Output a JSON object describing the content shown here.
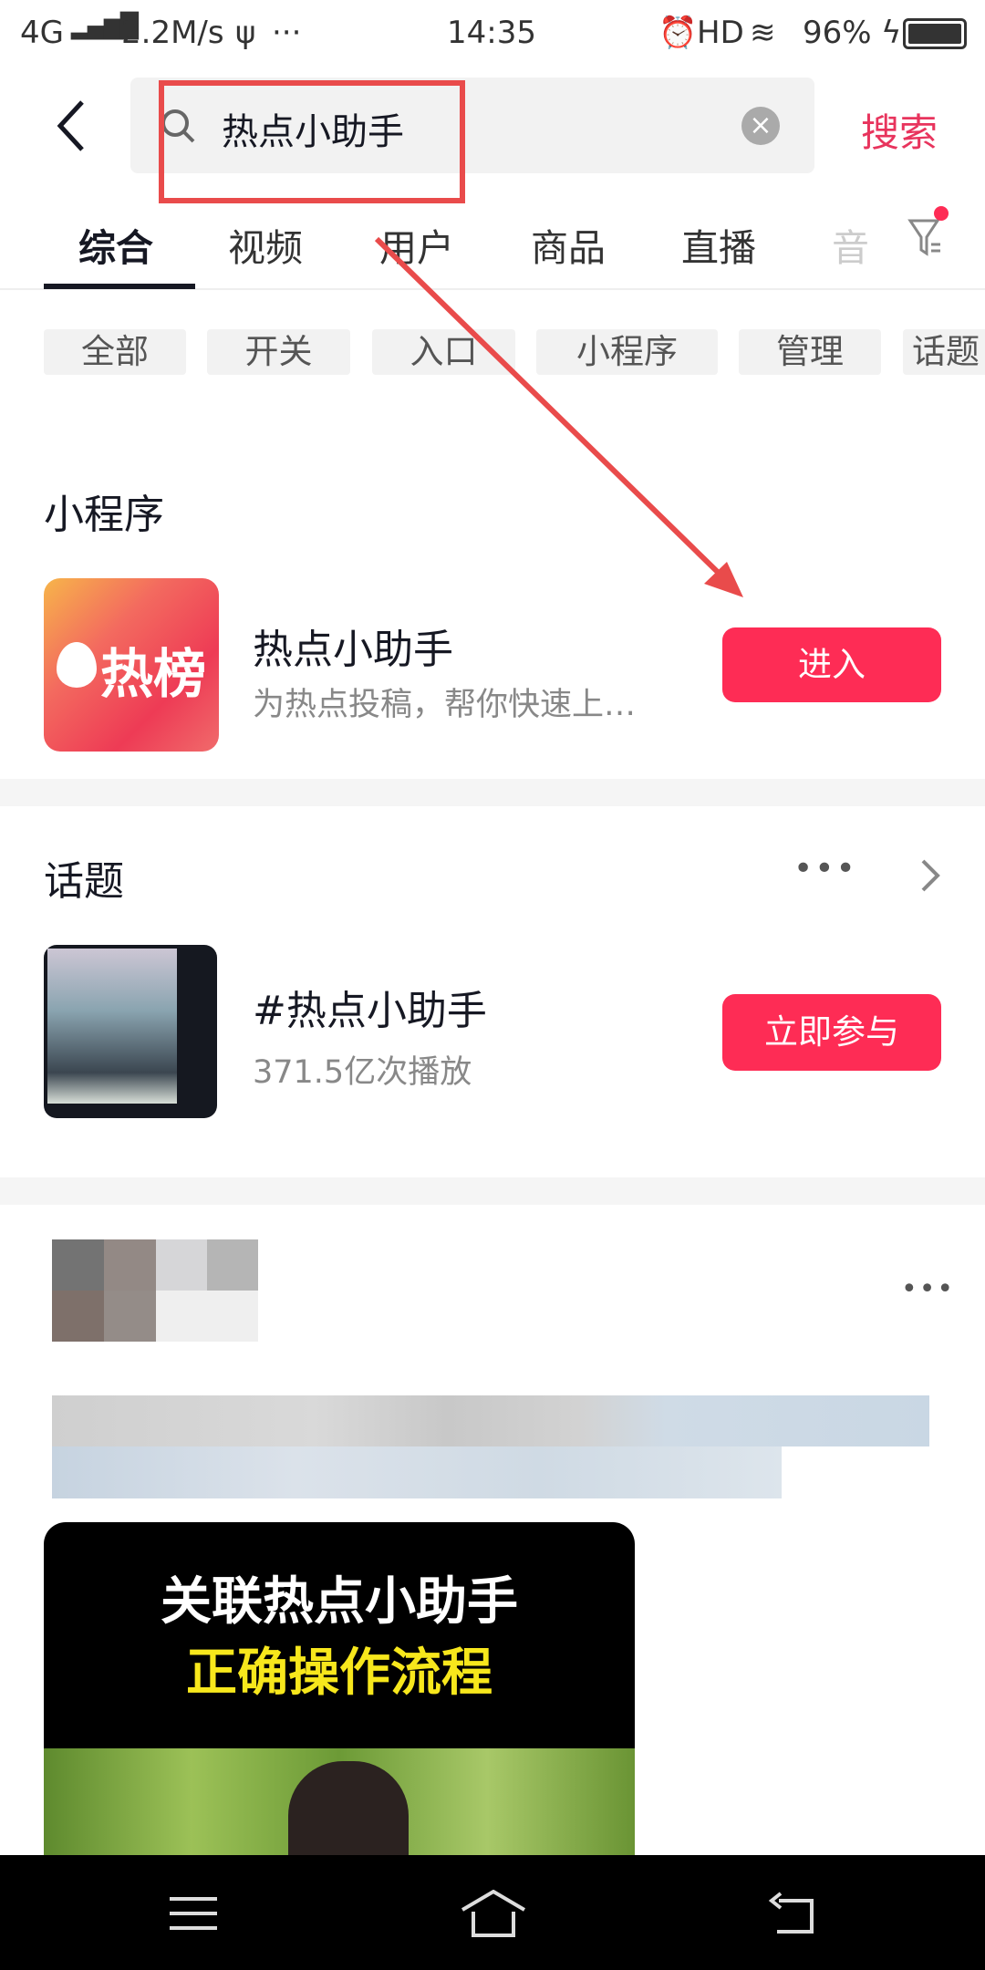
{
  "status_bar": {
    "network": "4G",
    "speed": "2.2M/s",
    "usb": "ψ",
    "more": "···",
    "time": "14:35",
    "hd": "HD",
    "battery": "96%"
  },
  "search": {
    "query": "热点小助手",
    "search_label": "搜索"
  },
  "tabs": [
    {
      "label": "综合"
    },
    {
      "label": "视频"
    },
    {
      "label": "用户"
    },
    {
      "label": "商品"
    },
    {
      "label": "直播"
    },
    {
      "label": "音"
    }
  ],
  "chips": [
    {
      "label": "全部"
    },
    {
      "label": "开关"
    },
    {
      "label": "入口"
    },
    {
      "label": "小程序"
    },
    {
      "label": "管理"
    },
    {
      "label": "话题"
    }
  ],
  "mini_program": {
    "heading": "小程序",
    "icon_text": "热榜",
    "name": "热点小助手",
    "desc": "为热点投稿，帮你快速上…",
    "button": "进入"
  },
  "topic": {
    "heading": "话题",
    "more": "•••",
    "name": "#热点小助手",
    "plays": "371.5亿次播放",
    "button": "立即参与"
  },
  "post": {
    "more": "•••",
    "video_line1": "关联热点小助手",
    "video_line2": "正确操作流程"
  },
  "colors": {
    "accent": "#fe2c55",
    "annotation": "#e94b4b"
  }
}
